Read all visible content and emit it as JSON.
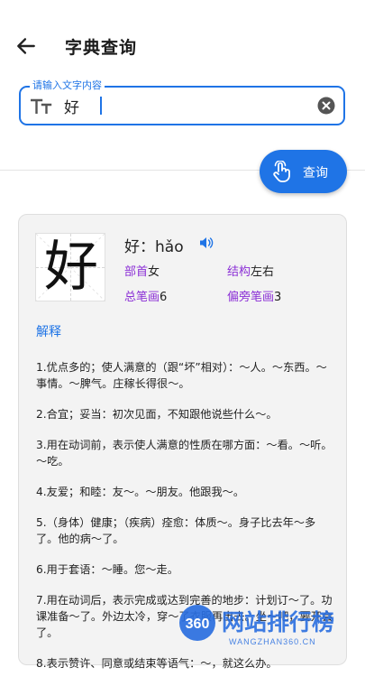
{
  "header": {
    "title": "字典查询"
  },
  "search": {
    "label": "请输入文字内容",
    "value": "好"
  },
  "query_button": {
    "label": "查询"
  },
  "result": {
    "char": "好",
    "head": "好：hǎo",
    "attrs": {
      "radical_key": "部首",
      "radical_val": "女",
      "structure_key": "结构",
      "structure_val": "左右",
      "strokes_key": "总笔画",
      "strokes_val": "6",
      "radical_strokes_key": "偏旁笔画",
      "radical_strokes_val": "3"
    },
    "section_title": "解释",
    "definitions": [
      "1.优点多的；使人满意的（跟“坏”相对）：～人。～东西。～事情。～脾气。庄稼长得很～。",
      "2.合宜；妥当：初次见面，不知跟他说些什么～。",
      "3.用在动词前，表示使人满意的性质在哪方面：～看。～听。～吃。",
      "4.友爱；和睦：友～。～朋友。他跟我～。",
      "5.（身体）健康；（疾病）痊愈：体质～。身子比去年～多了。他的病～了。",
      "6.用于套语：～睡。您～走。",
      "7.用在动词后，表示完成或达到完善的地步：计划订～了。功课准备～了。外边太冷，穿～了衣服再出去。坐～吧，要开会了。",
      "8.表示赞许、同意或结束等语气：～，就这么办。"
    ]
  },
  "watermark": {
    "logo_text": "360",
    "brand": "网站排行榜",
    "url": "WANGZHAN360.CN"
  },
  "colors": {
    "accent": "#1f74e6",
    "attr_key": "#8b2fd6"
  }
}
